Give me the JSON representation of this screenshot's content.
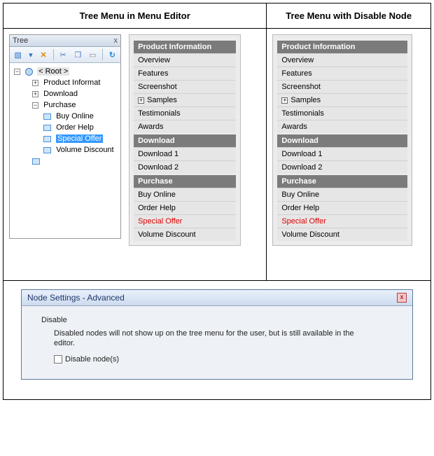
{
  "headers": {
    "left": "Tree Menu in Menu Editor",
    "right": "Tree Menu with Disable Node"
  },
  "treePanel": {
    "title": "Tree",
    "close": "x",
    "toolbar": {
      "new": "▧",
      "dropdown": "▾",
      "delete": "✕",
      "cut": "✂",
      "copy": "❐",
      "paste": "▭",
      "refresh": "↻"
    },
    "root": "< Root >",
    "nodes": {
      "n0": "Product Informat",
      "n1": "Download",
      "n2": "Purchase",
      "n2_0": "Buy Online",
      "n2_1": "Order Help",
      "n2_2": "Special Offer",
      "n2_3": "Volume Discount"
    }
  },
  "menuLeft": {
    "h0": "Product Information",
    "i0": "Overview",
    "i1": "Features",
    "i2": "Screenshot",
    "i3": "Samples",
    "i4": "Testimonials",
    "i5": "Awards",
    "h1": "Download",
    "i6": "Download 1",
    "i7": "Download 2",
    "h2": "Purchase",
    "i8": "Buy Online",
    "i9": "Order Help",
    "i10": "Special Offer",
    "i11": "Volume Discount"
  },
  "menuRight": {
    "h0": "Product Information",
    "i0": "Overview",
    "i1": "Features",
    "i2": "Screenshot",
    "i3": "Samples",
    "i4": "Testimonials",
    "i5": "Awards",
    "h1": "Download",
    "i6": "Download 1",
    "i7": "Download 2",
    "h2": "Purchase",
    "i8": "Buy Online",
    "i9": "Order Help",
    "i10": "Special Offer",
    "i11": "Volume Discount"
  },
  "dialog": {
    "title": "Node Settings - Advanced",
    "section": "Disable",
    "desc": "Disabled nodes will not show up on the tree menu for the user, but is still available in the editor.",
    "checkbox": "Disable node(s)"
  }
}
